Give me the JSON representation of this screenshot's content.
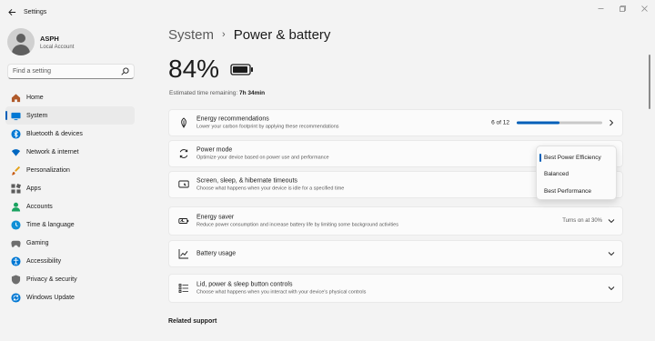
{
  "app": {
    "title": "Settings"
  },
  "user": {
    "name": "ASPH",
    "account": "Local Account"
  },
  "search": {
    "placeholder": "Find a setting"
  },
  "nav": [
    {
      "label": "Home",
      "icon": "home-icon",
      "active": false
    },
    {
      "label": "System",
      "icon": "system-icon",
      "active": true
    },
    {
      "label": "Bluetooth & devices",
      "icon": "bluetooth-icon",
      "active": false
    },
    {
      "label": "Network & internet",
      "icon": "wifi-icon",
      "active": false
    },
    {
      "label": "Personalization",
      "icon": "brush-icon",
      "active": false
    },
    {
      "label": "Apps",
      "icon": "apps-icon",
      "active": false
    },
    {
      "label": "Accounts",
      "icon": "accounts-icon",
      "active": false
    },
    {
      "label": "Time & language",
      "icon": "globe-clock-icon",
      "active": false
    },
    {
      "label": "Gaming",
      "icon": "gamepad-icon",
      "active": false
    },
    {
      "label": "Accessibility",
      "icon": "accessibility-icon",
      "active": false
    },
    {
      "label": "Privacy & security",
      "icon": "shield-icon",
      "active": false
    },
    {
      "label": "Windows Update",
      "icon": "update-icon",
      "active": false
    }
  ],
  "breadcrumb": {
    "parent": "System",
    "current": "Power & battery"
  },
  "battery": {
    "percent": "84%",
    "estimate_label": "Estimated time remaining: ",
    "estimate_value": "7h 34min"
  },
  "cards": {
    "energy_recommendations": {
      "title": "Energy recommendations",
      "desc": "Lower your carbon footprint by applying these recommendations",
      "progress_text": "6 of 12",
      "progress_fraction": 0.5
    },
    "power_mode": {
      "title": "Power mode",
      "desc": "Optimize your device based on power use and performance"
    },
    "screen_sleep": {
      "title": "Screen, sleep, & hibernate timeouts",
      "desc": "Choose what happens when your device is idle for a specified time"
    },
    "energy_saver": {
      "title": "Energy saver",
      "desc": "Reduce power consumption and increase battery life by limiting some background activities",
      "status": "Turns on at 30%"
    },
    "battery_usage": {
      "title": "Battery usage"
    },
    "lid_power": {
      "title": "Lid, power & sleep button controls",
      "desc": "Choose what happens when you interact with your device's physical controls"
    }
  },
  "power_mode_dropdown": {
    "options": [
      "Best Power Efficiency",
      "Balanced",
      "Best Performance"
    ],
    "selected": "Best Power Efficiency"
  },
  "related_support": {
    "heading": "Related support"
  },
  "colors": {
    "accent": "#005fb8",
    "background": "#f3f3f3",
    "card": "#fbfbfb"
  }
}
